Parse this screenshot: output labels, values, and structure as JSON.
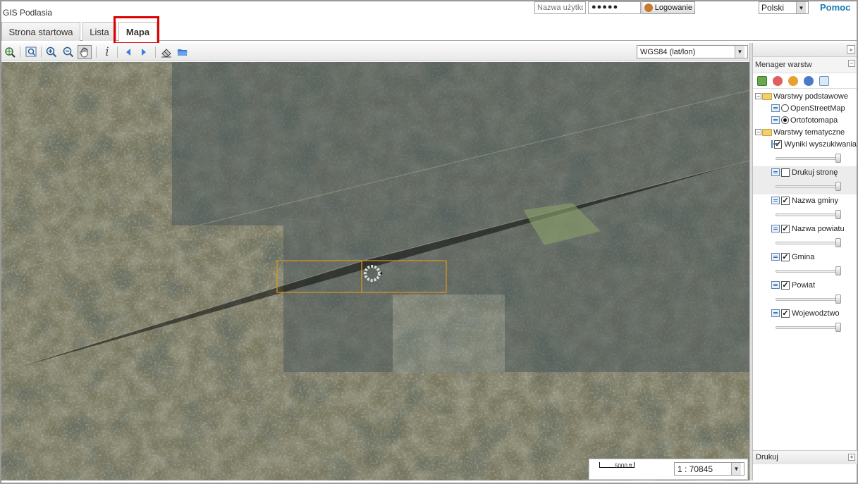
{
  "header": {
    "app_title": "GIS Podlasia",
    "username_placeholder": "Nazwa użytkownika",
    "password_value": "●●●●●",
    "login_button": "Logowanie",
    "language": "Polski",
    "help_link": "Pomoc"
  },
  "tabs": [
    {
      "label": "Strona startowa"
    },
    {
      "label": "Lista"
    },
    {
      "label": "Mapa",
      "active": true
    }
  ],
  "toolbar": {
    "tools": [
      "zoom-extent-icon",
      "zoom-box-icon",
      "zoom-in-icon",
      "zoom-out-icon",
      "pan-hand-icon",
      "info-icon",
      "back-arrow-icon",
      "forward-arrow-icon",
      "eraser-icon",
      "open-folder-icon"
    ],
    "projection": "WGS84 (lat/lon)"
  },
  "map": {
    "scale_bar_label": "5000 ft",
    "scale": "1 : 70845"
  },
  "layer_panel": {
    "title": "Menager warstw",
    "base_group": "Warstwy podstawowe",
    "base_layers": [
      {
        "label": "OpenStreetMap",
        "selected": false
      },
      {
        "label": "Ortofotomapa",
        "selected": true
      }
    ],
    "thematic_group": "Warstwy tematyczne",
    "thematic_layers": [
      {
        "label": "Wyniki wyszukiwania",
        "checked": true
      },
      {
        "label": "Drukuj stronę",
        "checked": false
      },
      {
        "label": "Nazwa gminy",
        "checked": true
      },
      {
        "label": "Nazwa powiatu",
        "checked": true
      },
      {
        "label": "Gmina",
        "checked": true
      },
      {
        "label": "Powiat",
        "checked": true
      },
      {
        "label": "Wojewodztwo",
        "checked": true
      }
    ],
    "print_section": "Drukuj"
  },
  "colors": {
    "highlight": "#e00000",
    "help_link": "#1a7bb0",
    "selection_box": "#d9951f"
  }
}
